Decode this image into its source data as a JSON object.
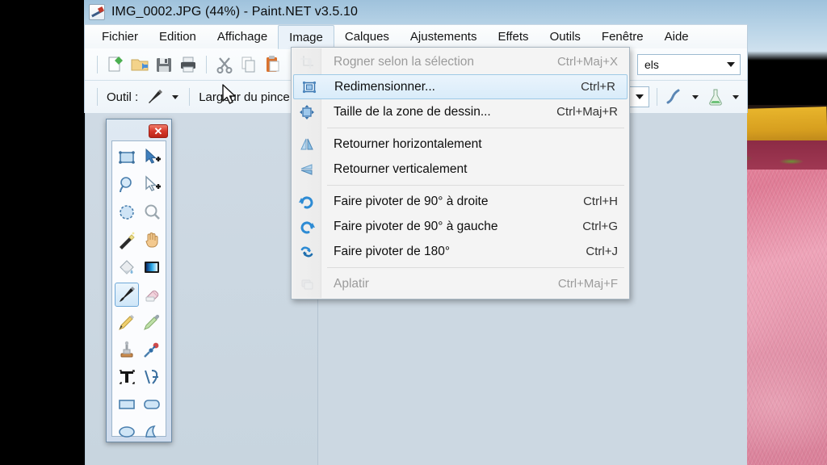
{
  "window": {
    "title": "IMG_0002.JPG (44%) - Paint.NET v3.5.10",
    "app_icon": "paintnet-icon"
  },
  "menubar": {
    "items": [
      {
        "label": "Fichier",
        "name": "menu-fichier",
        "open": false
      },
      {
        "label": "Edition",
        "name": "menu-edition",
        "open": false
      },
      {
        "label": "Affichage",
        "name": "menu-affichage",
        "open": false
      },
      {
        "label": "Image",
        "name": "menu-image",
        "open": true
      },
      {
        "label": "Calques",
        "name": "menu-calques",
        "open": false
      },
      {
        "label": "Ajustements",
        "name": "menu-ajustements",
        "open": false
      },
      {
        "label": "Effets",
        "name": "menu-effets",
        "open": false
      },
      {
        "label": "Outils",
        "name": "menu-outils",
        "open": false
      },
      {
        "label": "Fenêtre",
        "name": "menu-fenetre",
        "open": false
      },
      {
        "label": "Aide",
        "name": "menu-aide",
        "open": false
      }
    ]
  },
  "image_menu": {
    "items": [
      {
        "label": "Rogner selon la sélection",
        "accel": "Ctrl+Maj+X",
        "icon": "crop-to-selection-icon",
        "disabled": true,
        "highlight": false
      },
      {
        "label": "Redimensionner...",
        "accel": "Ctrl+R",
        "icon": "resize-image-icon",
        "disabled": false,
        "highlight": true
      },
      {
        "label": "Taille de la zone de dessin...",
        "accel": "Ctrl+Maj+R",
        "icon": "canvas-size-icon",
        "disabled": false,
        "highlight": false
      },
      {
        "separator": true
      },
      {
        "label": "Retourner horizontalement",
        "accel": "",
        "icon": "flip-horizontal-icon",
        "disabled": false,
        "highlight": false
      },
      {
        "label": "Retourner verticalement",
        "accel": "",
        "icon": "flip-vertical-icon",
        "disabled": false,
        "highlight": false
      },
      {
        "separator": true
      },
      {
        "label": "Faire pivoter de 90° à droite",
        "accel": "Ctrl+H",
        "icon": "rotate-right-icon",
        "disabled": false,
        "highlight": false
      },
      {
        "label": "Faire pivoter de 90° à gauche",
        "accel": "Ctrl+G",
        "icon": "rotate-left-icon",
        "disabled": false,
        "highlight": false
      },
      {
        "label": "Faire pivoter de 180°",
        "accel": "Ctrl+J",
        "icon": "rotate-180-icon",
        "disabled": false,
        "highlight": false
      },
      {
        "separator": true
      },
      {
        "label": "Aplatir",
        "accel": "Ctrl+Maj+F",
        "icon": "flatten-icon",
        "disabled": true,
        "highlight": false
      }
    ]
  },
  "toolbar_main": {
    "buttons": [
      {
        "name": "new-file-button",
        "icon": "new-file-icon"
      },
      {
        "name": "open-file-button",
        "icon": "open-folder-icon"
      },
      {
        "name": "save-file-button",
        "icon": "floppy-save-icon"
      },
      {
        "name": "print-button",
        "icon": "printer-icon"
      },
      {
        "name": "cut-button",
        "icon": "scissors-icon"
      },
      {
        "name": "copy-button",
        "icon": "copy-icon"
      },
      {
        "name": "paste-button",
        "icon": "clipboard-paste-icon"
      },
      {
        "name": "crop-button",
        "icon": "crop-icon"
      },
      {
        "name": "deselect-button",
        "icon": "deselect-icon"
      }
    ],
    "units_combo": {
      "value": "els",
      "name": "units-combo"
    }
  },
  "toolbar_options": {
    "tool_label": "Outil :",
    "active_tool_icon": "paintbrush-icon",
    "brush_width_label": "Largeur du pince",
    "width_combo_value": "",
    "blend_icon": "antialiasing-curve-icon",
    "flask_icon": "blend-mode-flask-icon"
  },
  "tools_palette": {
    "title": "",
    "close_label": "✕",
    "tools": [
      {
        "name": "tool-rectangle-select",
        "icon": "rectangle-select-icon",
        "selected": false
      },
      {
        "name": "tool-move-selected",
        "icon": "move-selected-icon",
        "selected": false
      },
      {
        "name": "tool-lasso-select",
        "icon": "lasso-select-icon",
        "selected": false
      },
      {
        "name": "tool-move-selection",
        "icon": "move-selection-icon",
        "selected": false
      },
      {
        "name": "tool-ellipse-select",
        "icon": "ellipse-select-icon",
        "selected": false
      },
      {
        "name": "tool-zoom",
        "icon": "magnifier-icon",
        "selected": false
      },
      {
        "name": "tool-magic-wand",
        "icon": "magic-wand-icon",
        "selected": false
      },
      {
        "name": "tool-pan",
        "icon": "hand-pan-icon",
        "selected": false
      },
      {
        "name": "tool-paint-bucket",
        "icon": "paint-bucket-icon",
        "selected": false
      },
      {
        "name": "tool-gradient",
        "icon": "gradient-icon",
        "selected": false
      },
      {
        "name": "tool-paintbrush",
        "icon": "paintbrush-icon",
        "selected": true
      },
      {
        "name": "tool-eraser",
        "icon": "eraser-icon",
        "selected": false
      },
      {
        "name": "tool-pencil",
        "icon": "pencil-icon",
        "selected": false
      },
      {
        "name": "tool-color-picker",
        "icon": "color-picker-icon",
        "selected": false
      },
      {
        "name": "tool-clone-stamp",
        "icon": "clone-stamp-icon",
        "selected": false
      },
      {
        "name": "tool-recolor",
        "icon": "recolor-pin-icon",
        "selected": false
      },
      {
        "name": "tool-text",
        "icon": "text-t-icon",
        "selected": false
      },
      {
        "name": "tool-line-curve",
        "icon": "line-curve-icon",
        "selected": false
      },
      {
        "name": "tool-rectangle",
        "icon": "rectangle-shape-icon",
        "selected": false
      },
      {
        "name": "tool-rounded-rectangle",
        "icon": "rounded-rectangle-icon",
        "selected": false
      },
      {
        "name": "tool-ellipse",
        "icon": "ellipse-shape-icon",
        "selected": false
      },
      {
        "name": "tool-freeform-shape",
        "icon": "freeform-shape-icon",
        "selected": false
      }
    ]
  },
  "cursor": {
    "name": "mouse-pointer",
    "icon": "arrow-cursor-icon"
  },
  "colors": {
    "menu_highlight": "#d9ecfa",
    "menu_highlight_border": "#9ec9e6",
    "canvas_bg": "#ccd8e2",
    "close_button": "#d6372a",
    "photo_pink": "#e98fae"
  }
}
